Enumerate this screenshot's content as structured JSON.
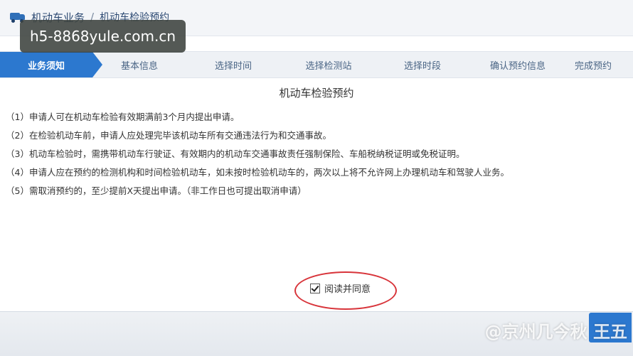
{
  "breadcrumb": {
    "root": "机动车业务",
    "separator": "/",
    "current": "机动车检验预约",
    "icon": "truck-icon"
  },
  "watermark": {
    "top": "h5-8868yule.com.cn",
    "bottom": "@京州几今秋 王五"
  },
  "steps": [
    {
      "label": "业务须知",
      "active": true
    },
    {
      "label": "基本信息",
      "active": false
    },
    {
      "label": "选择时间",
      "active": false
    },
    {
      "label": "选择检测站",
      "active": false
    },
    {
      "label": "选择时段",
      "active": false
    },
    {
      "label": "确认预约信息",
      "active": false
    },
    {
      "label": "完成预约",
      "active": false
    }
  ],
  "content": {
    "title": "机动车检验预约",
    "rules": [
      "（1）申请人可在机动车检验有效期满前3个月内提出申请。",
      "（2）在检验机动车前，申请人应处理完毕该机动车所有交通违法行为和交通事故。",
      "（3）机动车检验时，需携带机动车行驶证、有效期内的机动车交通事故责任强制保险、车船税纳税证明或免税证明。",
      "（4）申请人应在预约的检测机构和时间检验机动车，如未按时检验机动车的，两次以上将不允许网上办理机动车和驾驶人业务。",
      "（5）需取消预约的，至少提前X天提出申请。（非工作日也可提出取消申请）"
    ]
  },
  "agree": {
    "label": "阅读并同意",
    "checked": true
  },
  "colors": {
    "accent": "#2c78cf",
    "highlight_circle": "#d8343a"
  }
}
